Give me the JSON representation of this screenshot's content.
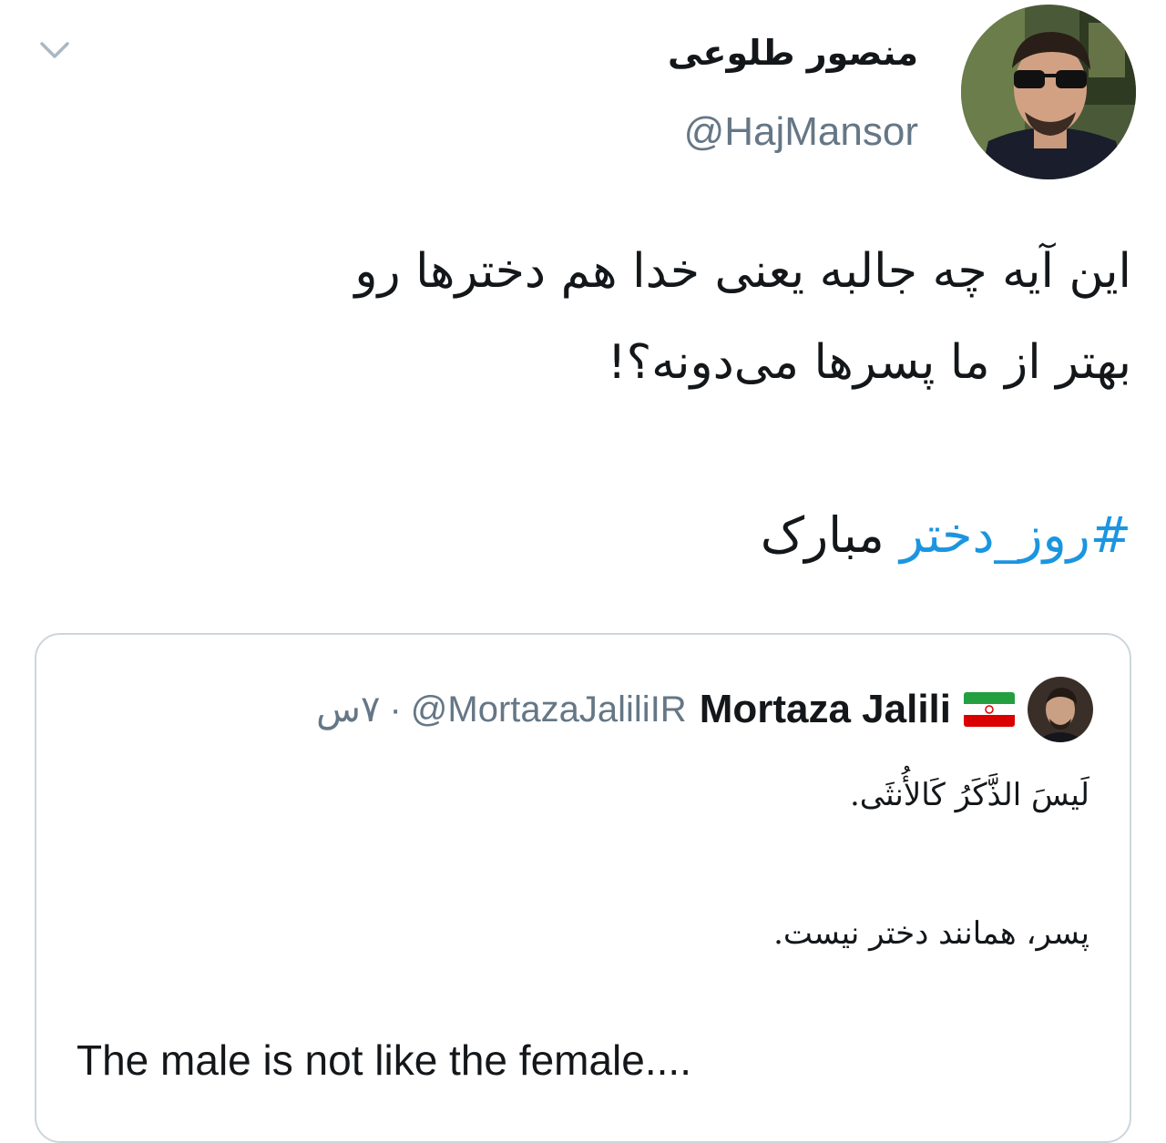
{
  "tweet": {
    "author_name": "منصور طلوعی",
    "author_handle": "@HajMansor",
    "text_line_1": "این آیه چه جالبه یعنی خدا هم دخترها رو",
    "text_line_2": "بهتر از ما پسرها می‌دونه؟!",
    "hashtag": "#روز_دختر",
    "hashtag_suffix": "مبارک",
    "avatar_icon": "avatar-photo",
    "menu_icon": "chevron-down-icon",
    "link_color": "#1b95e0",
    "secondary_text_color": "#657786"
  },
  "quoted_tweet": {
    "author_name": "Mortaza Jalili",
    "flag_icon": "iran-flag-emoji",
    "author_handle": "@MortazaJaliliIR",
    "separator": "·",
    "time": "۷س",
    "line_arabic": "لَيسَ الذَّكَرُ كَالأُنثَى.",
    "line_persian": "پسر، همانند دختر نیست.",
    "line_english": "The male is not like the female...."
  }
}
